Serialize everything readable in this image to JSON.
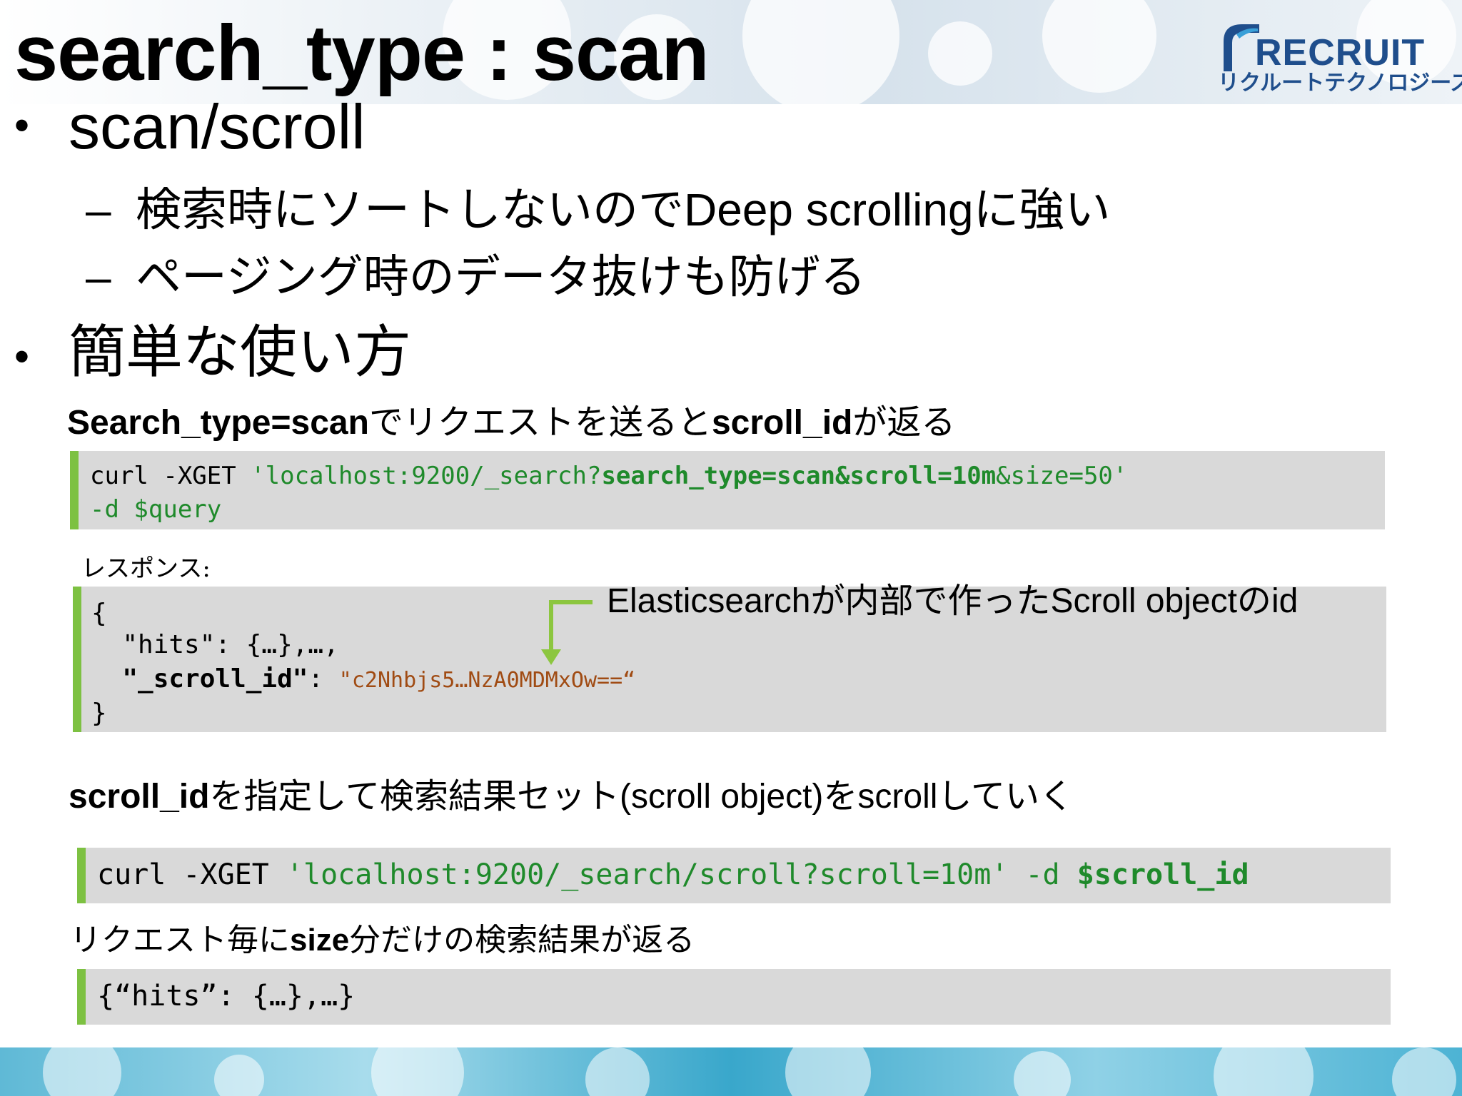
{
  "slide": {
    "title": "search_type : scan",
    "logo": {
      "name": "recruit-logo",
      "word": "RECRUIT",
      "subtitle": "リクルートテクノロジーズ",
      "color": "#1f4e8c"
    },
    "bullets": [
      {
        "text": "scan/scroll",
        "subitems": [
          {
            "jp1": "検索時にソートしないので",
            "en1": "Deep scrolling",
            "jp2": "に強い"
          },
          {
            "jp1": "ページング時のデータ抜けも防げる"
          }
        ]
      },
      {
        "text": "簡単な使い方"
      }
    ],
    "section1": {
      "part1": "Search_type=scan",
      "part2": "でリクエストを送ると",
      "part3": "scroll_id",
      "part4": "が返る"
    },
    "code1": {
      "line1_cmd": "curl -XGET ",
      "line1_str": "'localhost:9200/_search?",
      "line1_bold": "search_type=scan&scroll=10m",
      "line1_end": "&size=50'",
      "line2": "-d $query"
    },
    "response_label": "レスポンス:",
    "code2": {
      "line1": "{",
      "line2": "  \"hits\": {…},…,",
      "line3_key": "  \"_scroll_id\"",
      "line3_colon": ": ",
      "line3_value": "\"c2Nhbjs5…NzA0MDMxOw==“",
      "line4": "}"
    },
    "annotation": {
      "en1": "Elasticsearch",
      "jp1": "が内部で作った",
      "en2": "Scroll  object",
      "jp2": "の",
      "en3": "id"
    },
    "section2": {
      "part1": "scroll_id",
      "part2": "を指定して検索結果セット",
      "part3": "(scroll object)",
      "part4": "を",
      "part5": "scroll",
      "part6": "していく"
    },
    "code3": {
      "cmd": "curl ",
      "flag": "-XGET ",
      "str": "'localhost:9200/_search/scroll?scroll=10m'",
      "d": " -d ",
      "var": "$scroll_id"
    },
    "section3": {
      "part1": "リクエスト毎に",
      "part2": "size",
      "part3": "分だけの検索結果が返る"
    },
    "code4": {
      "line": "{“hits”: {…},…}"
    },
    "colors": {
      "accent_green": "#7dc142",
      "code_bg": "#d9d9d9",
      "code_green": "#1f8a2b",
      "code_brown": "#a04b13"
    }
  }
}
